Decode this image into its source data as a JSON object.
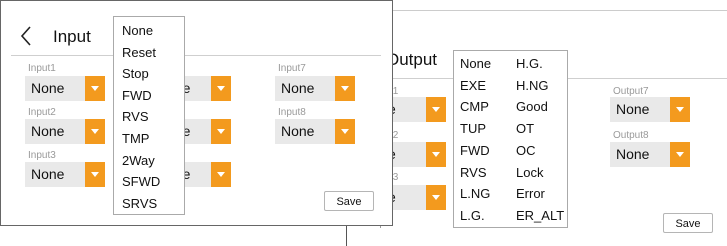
{
  "input_panel": {
    "title": "Input",
    "labels": {
      "input1": "Input1",
      "input2": "Input2",
      "input3": "Input3",
      "input7": "Input7",
      "input8": "Input8"
    },
    "values": {
      "input1": "None",
      "input2": "None",
      "input3": "None",
      "input4_partial": "None",
      "input5_partial": "None",
      "input6_partial": "None",
      "input7": "None",
      "input8": "None"
    },
    "save_label": "Save",
    "menu": [
      "None",
      "Reset",
      "Stop",
      "FWD",
      "RVS",
      "TMP",
      "2Way",
      "SFWD",
      "SRVS"
    ]
  },
  "output_panel": {
    "title": "Output",
    "labels": {
      "output1": "t1",
      "output2": "t2",
      "output3": "t3",
      "output7": "Output7",
      "output8": "Output8"
    },
    "values": {
      "output1": "e",
      "output2": "e",
      "output3": "e",
      "output7": "None",
      "output8": "None"
    },
    "save_label": "Save",
    "menu_col1": [
      "None",
      "EXE",
      "CMP",
      "TUP",
      "FWD",
      "RVS",
      "L.NG",
      "L.G."
    ],
    "menu_col2": [
      "H.G.",
      "H.NG",
      "Good",
      "OT",
      "OC",
      "Lock",
      "Error",
      "ER_ALT"
    ]
  },
  "colors": {
    "accent": "#f39a1e",
    "field_bg": "#e9e9e9"
  }
}
